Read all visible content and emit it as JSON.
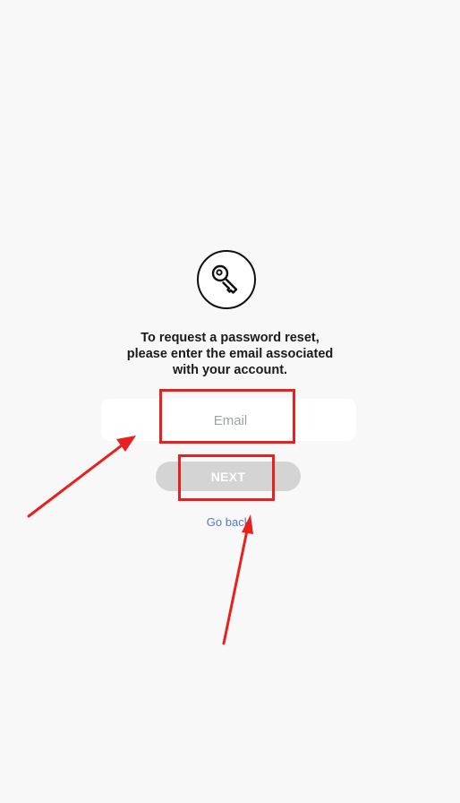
{
  "reset": {
    "instruction_text": "To request a password reset, please enter the email associated with your account.",
    "email_placeholder": "Email",
    "next_label": "NEXT",
    "go_back_label": "Go back"
  },
  "icons": {
    "header": "key-icon"
  },
  "colors": {
    "background": "#f8f8f9",
    "button_disabled": "#d4d4d4",
    "link": "#5b78c2",
    "annotation": "#e8201e"
  }
}
